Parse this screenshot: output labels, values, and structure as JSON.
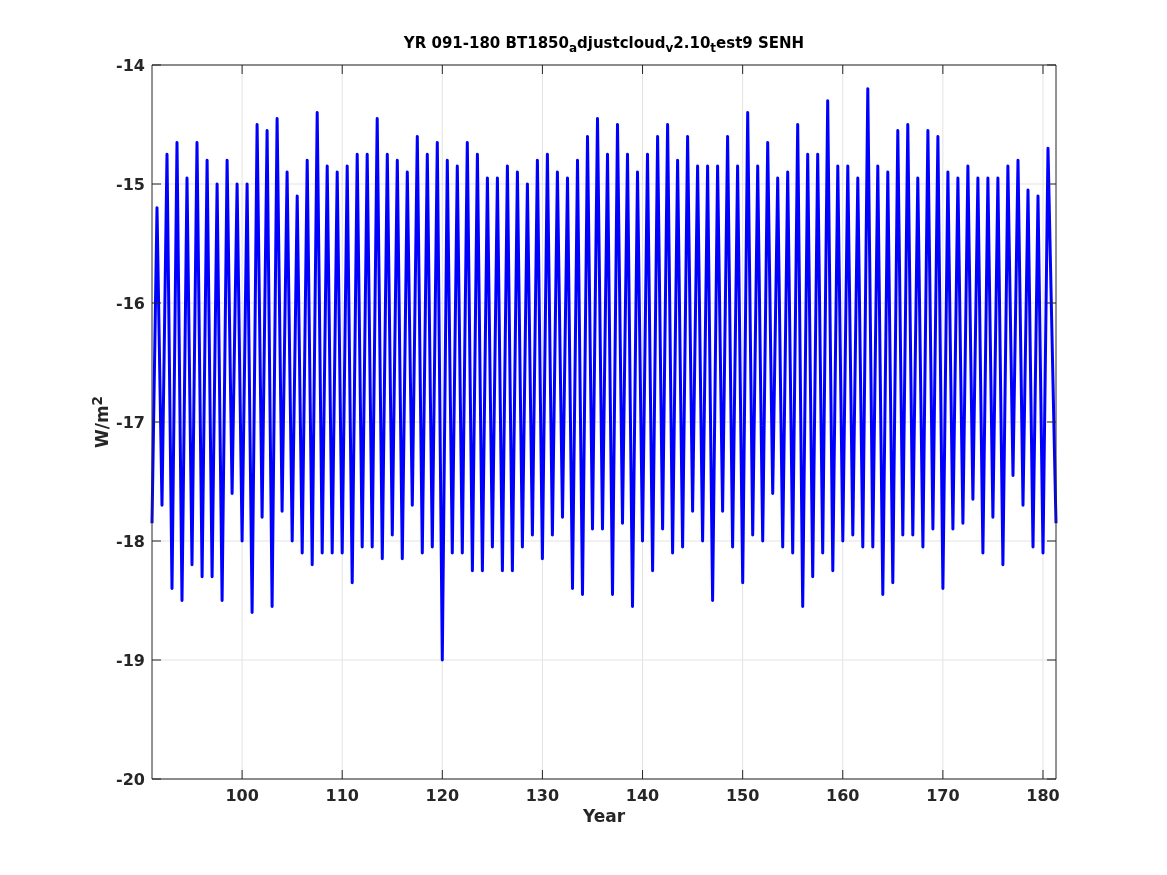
{
  "chart_data": {
    "type": "line",
    "title": "YR 091-180 BT1850$_{a}$djustcloud$_{v}$2.10$_{t}$est9 SENH",
    "xlabel": "Year",
    "ylabel": "W/m$^{2}$",
    "x": [
      91,
      91.5,
      92,
      92.5,
      93,
      93.5,
      94,
      94.5,
      95,
      95.5,
      96,
      96.5,
      97,
      97.5,
      98,
      98.5,
      99,
      99.5,
      100,
      100.5,
      101,
      101.5,
      102,
      102.5,
      103,
      103.5,
      104,
      104.5,
      105,
      105.5,
      106,
      106.5,
      107,
      107.5,
      108,
      108.5,
      109,
      109.5,
      110,
      110.5,
      111,
      111.5,
      112,
      112.5,
      113,
      113.5,
      114,
      114.5,
      115,
      115.5,
      116,
      116.5,
      117,
      117.5,
      118,
      118.5,
      119,
      119.5,
      120,
      120.5,
      121,
      121.5,
      122,
      122.5,
      123,
      123.5,
      124,
      124.5,
      125,
      125.5,
      126,
      126.5,
      127,
      127.5,
      128,
      128.5,
      129,
      129.5,
      130,
      130.5,
      131,
      131.5,
      132,
      132.5,
      133,
      133.5,
      134,
      134.5,
      135,
      135.5,
      136,
      136.5,
      137,
      137.5,
      138,
      138.5,
      139,
      139.5,
      140,
      140.5,
      141,
      141.5,
      142,
      142.5,
      143,
      143.5,
      144,
      144.5,
      145,
      145.5,
      146,
      146.5,
      147,
      147.5,
      148,
      148.5,
      149,
      149.5,
      150,
      150.5,
      151,
      151.5,
      152,
      152.5,
      153,
      153.5,
      154,
      154.5,
      155,
      155.5,
      156,
      156.5,
      157,
      157.5,
      158,
      158.5,
      159,
      159.5,
      160,
      160.5,
      161,
      161.5,
      162,
      162.5,
      163,
      163.5,
      164,
      164.5,
      165,
      165.5,
      166,
      166.5,
      167,
      167.5,
      168,
      168.5,
      169,
      169.5,
      170,
      170.5,
      171,
      171.5,
      172,
      172.5,
      173,
      173.5,
      174,
      174.5,
      175,
      175.5,
      176,
      176.5,
      177,
      177.5,
      178,
      178.5,
      179,
      179.5,
      180,
      180.5,
      181.3
    ],
    "series": [
      {
        "color": "#0000ff",
        "values": [
          -17.85,
          -15.2,
          -17.7,
          -14.75,
          -18.4,
          -14.65,
          -18.5,
          -14.95,
          -18.2,
          -14.65,
          -18.3,
          -14.8,
          -18.3,
          -15.0,
          -18.5,
          -14.8,
          -17.6,
          -15.0,
          -18.0,
          -15.0,
          -18.6,
          -14.5,
          -17.8,
          -14.55,
          -18.55,
          -14.45,
          -17.75,
          -14.9,
          -18.0,
          -15.1,
          -18.1,
          -14.8,
          -18.2,
          -14.4,
          -18.1,
          -14.85,
          -18.1,
          -14.9,
          -18.1,
          -14.85,
          -18.35,
          -14.75,
          -18.05,
          -14.75,
          -18.05,
          -14.45,
          -18.15,
          -14.75,
          -17.95,
          -14.8,
          -18.15,
          -14.9,
          -17.7,
          -14.6,
          -18.1,
          -14.75,
          -18.05,
          -14.65,
          -19.0,
          -14.8,
          -18.1,
          -14.85,
          -18.1,
          -14.65,
          -18.25,
          -14.75,
          -18.25,
          -14.95,
          -18.05,
          -14.95,
          -18.25,
          -14.85,
          -18.25,
          -14.9,
          -18.05,
          -15.0,
          -17.95,
          -14.8,
          -18.15,
          -14.75,
          -17.95,
          -14.9,
          -17.8,
          -14.95,
          -18.4,
          -14.8,
          -18.45,
          -14.6,
          -17.9,
          -14.45,
          -17.9,
          -14.75,
          -18.45,
          -14.5,
          -17.85,
          -14.75,
          -18.55,
          -14.9,
          -18.0,
          -14.75,
          -18.25,
          -14.6,
          -17.9,
          -14.5,
          -18.1,
          -14.8,
          -18.05,
          -14.6,
          -17.75,
          -14.85,
          -18.0,
          -14.85,
          -18.5,
          -14.85,
          -17.75,
          -14.6,
          -18.05,
          -14.85,
          -18.35,
          -14.4,
          -17.95,
          -14.85,
          -18.0,
          -14.65,
          -17.6,
          -14.95,
          -18.05,
          -14.9,
          -18.1,
          -14.5,
          -18.55,
          -14.75,
          -18.3,
          -14.75,
          -18.1,
          -14.3,
          -18.25,
          -14.85,
          -18.0,
          -14.85,
          -17.95,
          -14.95,
          -18.05,
          -14.2,
          -18.05,
          -14.85,
          -18.45,
          -14.9,
          -18.35,
          -14.55,
          -17.95,
          -14.5,
          -17.95,
          -14.95,
          -18.05,
          -14.55,
          -17.9,
          -14.6,
          -18.4,
          -14.9,
          -17.9,
          -14.95,
          -17.85,
          -14.85,
          -17.65,
          -14.95,
          -18.1,
          -14.95,
          -17.8,
          -14.95,
          -18.2,
          -14.85,
          -17.45,
          -14.8,
          -17.7,
          -15.05,
          -18.05,
          -15.1,
          -18.1,
          -14.7,
          -17.85
        ]
      }
    ],
    "xlim": [
      91,
      181.3
    ],
    "ylim": [
      -20,
      -14
    ],
    "xticks": [
      100,
      110,
      120,
      130,
      140,
      150,
      160,
      170,
      180
    ],
    "yticks": [
      -20,
      -19,
      -18,
      -17,
      -16,
      -15,
      -14
    ],
    "grid": true
  }
}
